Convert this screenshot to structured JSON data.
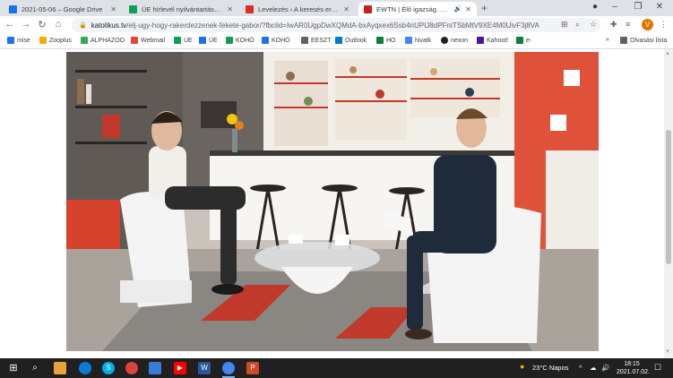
{
  "browser": {
    "tabs": [
      {
        "title": "2021-05-06 – Google Drive",
        "favicon": "google-drive-icon",
        "color": "#1a73e8",
        "active": false
      },
      {
        "title": "ÚE hírlevél nyilvántartása - Goog",
        "favicon": "google-sheets-icon",
        "color": "#0f9d58",
        "active": false
      },
      {
        "title": "Levelezés ‹ A keresés eredménye",
        "favicon": "gmail-icon",
        "color": "#d93025",
        "active": false
      },
      {
        "title": "EWTN | Élő igazság. Katoliku",
        "favicon": "ewtn-icon",
        "color": "#c5221f",
        "active": true
      }
    ],
    "window_controls": {
      "minimize": "–",
      "maximize": "❐",
      "close": "✕"
    },
    "address": {
      "host": "katolikus.tv",
      "path": "/elj-ugy-hogy-rakerdezzenek-fekete-gabor/?fbclid=IwAR0UgpDwXQMdA-bxAyqxex6Ssb4nUPIJ8dPFnITSbMtV9XE4M0UivF3j8VA"
    },
    "profile_initial": "V",
    "bookmarks": [
      {
        "label": "mise",
        "color": "#1a73e8"
      },
      {
        "label": "Zooplus",
        "color": "#f9ab00"
      },
      {
        "label": "ALPHAZOO",
        "color": "#34a853"
      },
      {
        "label": "Webmail",
        "color": "#ea4335"
      },
      {
        "label": "ÚE",
        "color": "#0f9d58"
      },
      {
        "label": "ÚE",
        "color": "#1a73e8"
      },
      {
        "label": "KOHÓ",
        "color": "#0f9d58"
      },
      {
        "label": "KOHÓ",
        "color": "#1a73e8"
      },
      {
        "label": "EESZT",
        "color": "#5f6368"
      },
      {
        "label": "Outlook",
        "color": "#0078d4"
      },
      {
        "label": "HO",
        "color": "#107c41"
      },
      {
        "label": "hivatk",
        "color": "#4285f4"
      },
      {
        "label": "nexon",
        "color": "#202124"
      },
      {
        "label": "Kahoot!",
        "color": "#46178f"
      },
      {
        "label": "e-",
        "color": "#107c41"
      }
    ],
    "bookmarks_more": "»",
    "reading_list": "Olvasási lista"
  },
  "taskbar": {
    "weather": "23°C  Napos",
    "time": "18:15",
    "date": "2021.07.02.",
    "apps": [
      "file-explorer-icon",
      "edge-icon",
      "skype-icon",
      "chrome-icon",
      "photos-icon",
      "youtube-icon",
      "word-icon",
      "chrome-active-icon",
      "powerpoint-icon"
    ]
  }
}
